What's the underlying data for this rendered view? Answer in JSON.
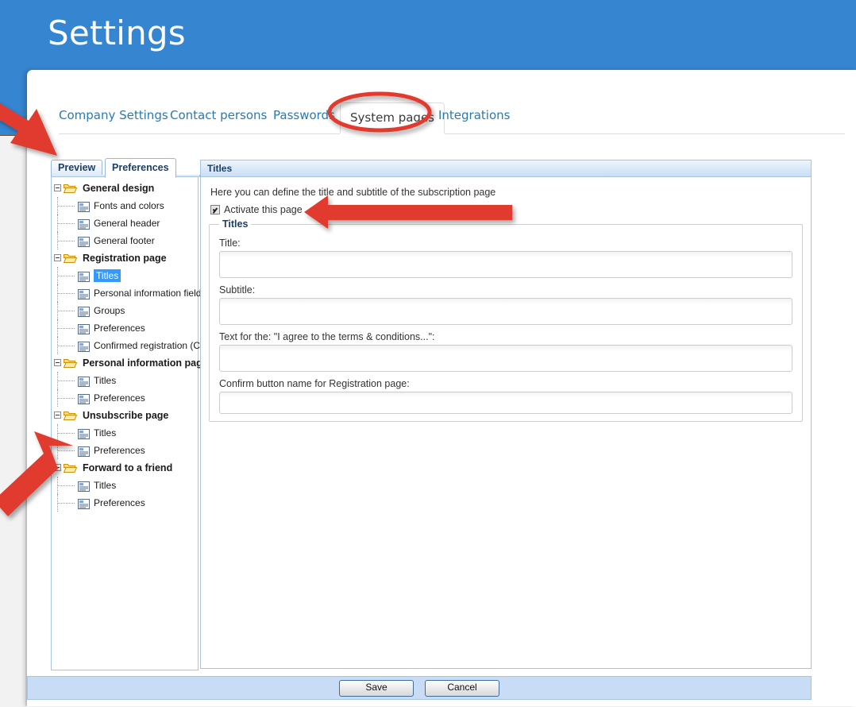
{
  "header": {
    "title": "Settings",
    "bg_color": "#3585d0"
  },
  "tabs": [
    {
      "label": "Company Settings",
      "active": false
    },
    {
      "label": "Contact persons",
      "active": false
    },
    {
      "label": "Passwords",
      "active": false
    },
    {
      "label": "System pages",
      "active": true
    },
    {
      "label": "Integrations",
      "active": false
    }
  ],
  "tree_tabs": [
    {
      "label": "Preview",
      "active": false
    },
    {
      "label": "Preferences",
      "active": true
    }
  ],
  "tree": [
    {
      "type": "group",
      "label": "General design",
      "icon": "folder-open-icon"
    },
    {
      "type": "child",
      "label": "Fonts and colors",
      "icon": "page-icon",
      "selected": false
    },
    {
      "type": "child",
      "label": "General header",
      "icon": "page-icon",
      "selected": false
    },
    {
      "type": "child",
      "label": "General footer",
      "icon": "page-icon",
      "selected": false
    },
    {
      "type": "group",
      "label": "Registration page",
      "icon": "folder-open-icon"
    },
    {
      "type": "child",
      "label": "Titles",
      "icon": "page-icon",
      "selected": true
    },
    {
      "type": "child",
      "label": "Personal information fields",
      "icon": "page-icon",
      "selected": false
    },
    {
      "type": "child",
      "label": "Groups",
      "icon": "page-icon",
      "selected": false
    },
    {
      "type": "child",
      "label": "Preferences",
      "icon": "page-icon",
      "selected": false
    },
    {
      "type": "child",
      "label": "Confirmed registration (Con",
      "icon": "page-icon",
      "selected": false
    },
    {
      "type": "group",
      "label": "Personal information page",
      "icon": "folder-open-icon"
    },
    {
      "type": "child",
      "label": "Titles",
      "icon": "page-icon",
      "selected": false
    },
    {
      "type": "child",
      "label": "Preferences",
      "icon": "page-icon",
      "selected": false
    },
    {
      "type": "group",
      "label": "Unsubscribe page",
      "icon": "folder-open-icon"
    },
    {
      "type": "child",
      "label": "Titles",
      "icon": "page-icon",
      "selected": false
    },
    {
      "type": "child",
      "label": "Preferences",
      "icon": "page-icon",
      "selected": false
    },
    {
      "type": "group",
      "label": "Forward to a friend",
      "icon": "folder-open-icon"
    },
    {
      "type": "child",
      "label": "Titles",
      "icon": "page-icon",
      "selected": false
    },
    {
      "type": "child",
      "label": "Preferences",
      "icon": "page-icon",
      "selected": false
    }
  ],
  "content": {
    "panel_title": "Titles",
    "description": "Here you can define the title and subtitle of the subscription page",
    "activate_label": "Activate this page",
    "activate_checked": true,
    "fieldset_legend": "Titles",
    "fields": [
      {
        "label": "Title:",
        "value": "",
        "placeholder": ""
      },
      {
        "label": "Subtitle:",
        "value": "",
        "placeholder": ""
      },
      {
        "label": "Text for the: \"I agree to the terms & conditions...\":",
        "value": "",
        "placeholder": ""
      },
      {
        "label": "Confirm button name for Registration page:",
        "value": "",
        "placeholder": ""
      }
    ]
  },
  "footer": {
    "save_label": "Save",
    "cancel_label": "Cancel"
  },
  "annotations": {
    "color": "#e03b2e",
    "ellipse_target": "System pages",
    "arrows": [
      {
        "name": "arrow-to-preview-tabs",
        "points_to": "Preview / Preferences tabs"
      },
      {
        "name": "arrow-to-activate-checkbox",
        "points_to": "Activate this page"
      },
      {
        "name": "arrow-to-forward-to-a-friend",
        "points_to": "Forward to a friend"
      }
    ]
  }
}
